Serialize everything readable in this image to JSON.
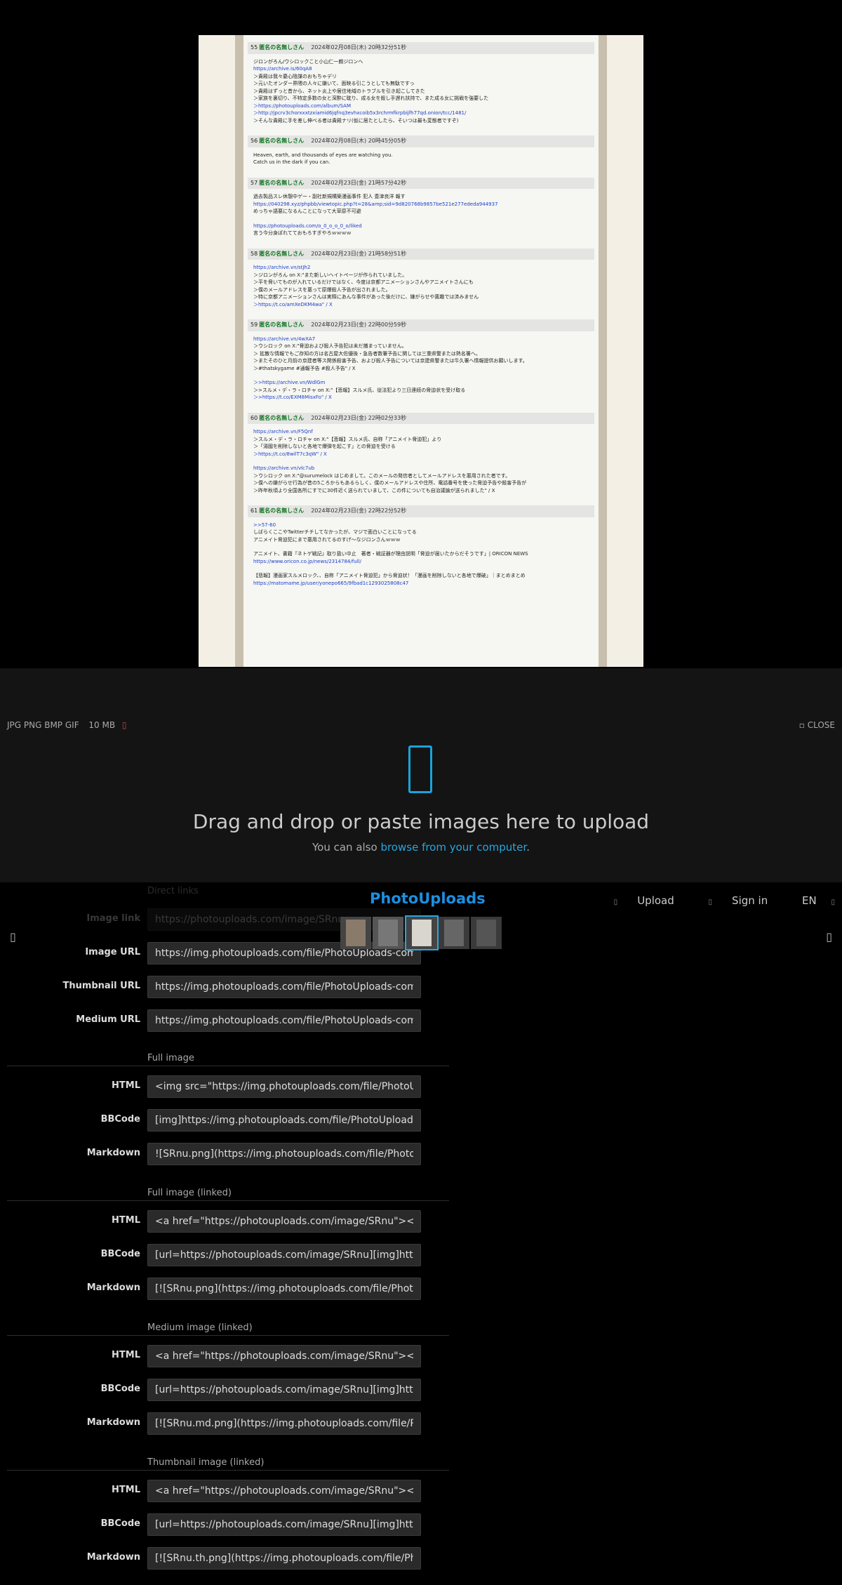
{
  "document": {
    "posts": [
      {
        "num": "55",
        "name": "匿名の名無しさん",
        "date": "2024年02月08日(木) 20時32分51秒",
        "lines": [
          {
            "t": "ジロンがろん/ウシロックこと小山仁一朗ジロンへ",
            "link": false
          },
          {
            "t": "https://archive.is/60qA8",
            "link": true
          },
          {
            "t": "＞貴殿は我々憂心陰謀のおもちゃデリ",
            "link": false
          },
          {
            "t": "＞元いたオンダー界隈の人々に嫌いて、面映る引こうとしても無駄ですっ",
            "link": false
          },
          {
            "t": "＞貴殿はずっと昔から、ネット炎上や居住地域のトラブルを引き起こしてきた",
            "link": false
          },
          {
            "t": "＞家族を裏切り、不特定多数の女と深酔に耽り、成る女を殺し手遅れ扶持で、また成る女に挑戦を強要した",
            "link": false
          },
          {
            "t": "＞https://photouploads.com/album/SAM",
            "link": true
          },
          {
            "t": "＞http://jpcrv3chorxxxtzxiamid6jqfnq3evhxcoib5x3rchrmfkrpbijfh77qd.onion/tcc/1481/",
            "link": true
          },
          {
            "t": "＞そんな貴殿に手を差し伸べる者は貴殿ナリ(仮に居たとしたら、そいつは最も変態者ですぞ)",
            "link": false
          }
        ]
      },
      {
        "num": "56",
        "name": "匿名の名無しさん",
        "date": "2024年02月08日(木) 20時45分05秒",
        "lines": [
          {
            "t": "Heaven, earth, and thousands of eyes are watching you.",
            "link": false
          },
          {
            "t": "Catch us in the dark if you can.",
            "link": false
          }
        ]
      },
      {
        "num": "57",
        "name": "匿名の名無しさん",
        "date": "2024年02月23日(金) 21時57分42秒",
        "lines": [
          {
            "t": "過去製品スレ休憩中ゲー・副社新規構築漫画事件 犯人 豊津良洋 報す",
            "link": false
          },
          {
            "t": "https://040298.xyz/phpbb/viewtopic.php?t=28&amp;sid=9d820768b9857be521e277ededa944937",
            "link": true
          },
          {
            "t": "めっちゃ語悪になるんことになって大草原不可避",
            "link": false
          },
          {
            "t": "",
            "link": false
          },
          {
            "t": "https://photouploads.com/o_0_o_o_0_o/liked",
            "link": true
          },
          {
            "t": "言う今分身ぽれてておもろすぎやろｗｗｗｗ",
            "link": false
          }
        ]
      },
      {
        "num": "58",
        "name": "匿名の名無しさん",
        "date": "2024年02月23日(金) 21時58分51秒",
        "lines": [
          {
            "t": "https://archive.vn/stJh2",
            "link": true
          },
          {
            "t": "＞ジロンがろん on X:\"また新しいヘイトページが作られていました。",
            "link": false
          },
          {
            "t": "＞平を脅いてものが入れているだけではなく、今度は京都アニメーションさんやアニメイトさんにも",
            "link": false
          },
          {
            "t": "＞僕のメールアドレスを悪って原爆殺人予告が出されました。",
            "link": false
          },
          {
            "t": "＞特に京都アニメーションさんは実際にあんな事件があった後だけに、嫌がらせや悪趣では済みません",
            "link": false
          },
          {
            "t": "＞https://t.co/amXeDKM4wa\" / X",
            "link": true
          }
        ]
      },
      {
        "num": "59",
        "name": "匿名の名無しさん",
        "date": "2024年02月23日(金) 22時00分59秒",
        "lines": [
          {
            "t": "https://archive.vn/4wXA7",
            "link": true
          },
          {
            "t": "＞ウシロック on X:\"脅迫および殺人予告犯は未だ捕まっていません。",
            "link": false
          },
          {
            "t": "＞ 拡散な情報でもご存知の方は名古屋大佐優後・急告者数署予告に関しては三重県警または熱名署へ。",
            "link": false
          },
          {
            "t": "＞またそのひと月前の京建者等ス関係殺害予告、および殺人予告については京建県警または牛久署へ情報提供お願いします。",
            "link": false
          },
          {
            "t": "＞#thatskygame #通報予告 #殺人予告\" / X",
            "link": false
          },
          {
            "t": "",
            "link": false
          },
          {
            "t": "＞>https://archive.vn/WdlGm",
            "link": true
          },
          {
            "t": "＞>スルメ・デ・ラ・ロチャ on X:\"【悲報】スルメ氏、従法犯より三日連続の脅迫状を受け取る",
            "link": false
          },
          {
            "t": "＞>https://t.co/EXM8MisxFo\" / X",
            "link": true
          }
        ]
      },
      {
        "num": "60",
        "name": "匿名の名無しさん",
        "date": "2024年02月23日(金) 22時02分33秒",
        "lines": [
          {
            "t": "https://archive.vn/F5Qnf",
            "link": true
          },
          {
            "t": "＞スルメ・デ・ラ・ロチャ on X:\"【悲報】スルメ氏、自称「アニメイト脅迫犯」より",
            "link": false
          },
          {
            "t": "＞「湯國を削除しないと各地で爆弾を起こす」との脅迫を受ける",
            "link": false
          },
          {
            "t": "＞https://t.co/8wilT7c3qW\" / X",
            "link": true
          },
          {
            "t": "",
            "link": false
          },
          {
            "t": "https://archive.vn/vlc7ub",
            "link": true
          },
          {
            "t": "＞ウシロック on X:\"@surumelock はじめまして。このメールの発信者としてメールアドレスを悪用された者です。",
            "link": false
          },
          {
            "t": "＞僕への嫌がらせ行為が昔の5ころからもあるらしく、僕のメールアドレスや住所、電話番号を使った脅迫予告や殺害予告が",
            "link": false
          },
          {
            "t": "＞昨年秋頃より全国各所にすでに30件近く送られていまして、この件についても自治議論が送られました\" / X",
            "link": false
          }
        ]
      },
      {
        "num": "61",
        "name": "匿名の名無しさん",
        "date": "2024年02月23日(金) 22時22分52秒",
        "lines": [
          {
            "t": ">>57-60",
            "link": true
          },
          {
            "t": "しばらくここやTwitterチチしてなかったが、マジで面白いことになってる",
            "link": false
          },
          {
            "t": "アニメイト脅迫犯にまで悪用されてるのすげ〜なジロンさんｗｗｗ",
            "link": false
          },
          {
            "t": "",
            "link": false
          },
          {
            "t": "アニメイト、書籍『ネトゲ戦記』取り扱い中止　著者・戦証器が理由説明「脅迫が届いたからだそうです」| ORICON NEWS",
            "link": false
          },
          {
            "t": "https://www.oricon.co.jp/news/2314784/full/",
            "link": true
          },
          {
            "t": "",
            "link": false
          },
          {
            "t": "【悲報】漫画家スルメロック、、自称「アニメイト脅迫犯」から脅迫状！「漫画を削除しないと各地で爆破」｜まとめまとめ",
            "link": false
          },
          {
            "t": "https://matomame.jp/user/yonepo665/9fbad1c1293025808c47",
            "link": true
          }
        ]
      }
    ]
  },
  "uploader": {
    "types": "JPG PNG BMP GIF",
    "max_size": "10 MB",
    "close_label": "CLOSE",
    "title": "Drag and drop or paste images here to upload",
    "sub_prefix": "You can also ",
    "browse_label": "browse from your computer",
    "sub_suffix": "."
  },
  "topbar": {
    "logo": "PhotoUploads",
    "upload_label": "Upload",
    "signin_label": "Sign in",
    "lang_label": "EN"
  },
  "links": {
    "direct": {
      "title": "Direct links",
      "rows": [
        {
          "label": "Image link",
          "value": "https://photouploads.com/image/SRnu"
        },
        {
          "label": "Image URL",
          "value": "https://img.photouploads.com/file/PhotoUploads-com/SRnu.png"
        },
        {
          "label": "Thumbnail URL",
          "value": "https://img.photouploads.com/file/PhotoUploads-com/SRnu.th.png"
        },
        {
          "label": "Medium URL",
          "value": "https://img.photouploads.com/file/PhotoUploads-com/SRnu.md.png"
        }
      ]
    },
    "full": {
      "title": "Full image",
      "rows": [
        {
          "label": "HTML",
          "value": "<img src=\"https://img.photouploads.com/file/PhotoUploads-com/SRnu.png\" alt=\"SRnu.png\" border=\"0\">"
        },
        {
          "label": "BBCode",
          "value": "[img]https://img.photouploads.com/file/PhotoUploads-com/SRnu.png[/img]"
        },
        {
          "label": "Markdown",
          "value": "![SRnu.png](https://img.photouploads.com/file/PhotoUploads-com/SRnu.png)"
        }
      ]
    },
    "full_linked": {
      "title": "Full image (linked)",
      "rows": [
        {
          "label": "HTML",
          "value": "<a href=\"https://photouploads.com/image/SRnu\"><img src=\"https://img.photouploads.com/file/PhotoUploads-com/SRnu.png\"></a>"
        },
        {
          "label": "BBCode",
          "value": "[url=https://photouploads.com/image/SRnu][img]https://img.photouploads.com/file/PhotoUploads-com/SRnu.png[/img][/url]"
        },
        {
          "label": "Markdown",
          "value": "[![SRnu.png](https://img.photouploads.com/file/PhotoUploads-com/SRnu.png)](https://photouploads.com/image/SRnu)"
        }
      ]
    },
    "medium_linked": {
      "title": "Medium image (linked)",
      "rows": [
        {
          "label": "HTML",
          "value": "<a href=\"https://photouploads.com/image/SRnu\"><img src=\"https://img.photouploads.com/file/PhotoUploads-com/SRnu.md.png\"></a>"
        },
        {
          "label": "BBCode",
          "value": "[url=https://photouploads.com/image/SRnu][img]https://img.photouploads.com/file/PhotoUploads-com/SRnu.md.png[/img][/url]"
        },
        {
          "label": "Markdown",
          "value": "[![SRnu.md.png](https://img.photouploads.com/file/PhotoUploads-com/SRnu.md.png)](https://photouploads.com/image/SRnu)"
        }
      ]
    },
    "thumb_linked": {
      "title": "Thumbnail image (linked)",
      "rows": [
        {
          "label": "HTML",
          "value": "<a href=\"https://photouploads.com/image/SRnu\"><img src=\"https://img.photouploads.com/file/PhotoUploads-com/SRnu.th.png\"></a>"
        },
        {
          "label": "BBCode",
          "value": "[url=https://photouploads.com/image/SRnu][img]https://img.photouploads.com/file/PhotoUploads-com/SRnu.th.png[/img][/url]"
        },
        {
          "label": "Markdown",
          "value": "[![SRnu.th.png](https://img.photouploads.com/file/PhotoUploads-com/SRnu.th.png)](https://photouploads.com/image/SRnu)"
        }
      ]
    }
  },
  "icons": {
    "upload": "upload-icon",
    "signin": "user-icon",
    "lang": "globe-icon",
    "menu": "menu-icon",
    "prev": "chevron-left-icon",
    "next": "chevron-right-icon"
  },
  "colors": {
    "accent": "#2aa5e0",
    "logo": "#1c8fe0",
    "poster_name": "#117722",
    "link": "#1a3fcc"
  }
}
